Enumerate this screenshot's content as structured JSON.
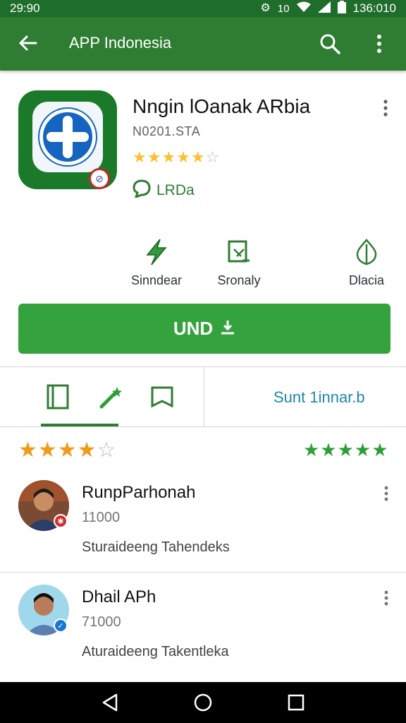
{
  "status_bar": {
    "time": "29:90",
    "clock_right": "136:010",
    "extra_text": "10"
  },
  "app_bar": {
    "title": "APP Indonesia"
  },
  "app": {
    "name": "Nngin lOanak ARbia",
    "developer": "N0201.STA",
    "rating_stars": 4.5,
    "tag": "LRDa"
  },
  "features": [
    {
      "label": "Sinndear",
      "icon": "bolt-icon"
    },
    {
      "label": "Sronaly",
      "icon": "edit-note-icon"
    },
    {
      "label": "Dlacia",
      "icon": "leaf-icon"
    }
  ],
  "install": {
    "label": "UND"
  },
  "tabs": {
    "text": "Sunt 1innar.b"
  },
  "ratings": {
    "left_stars": 4,
    "right_stars": 5
  },
  "reviews": [
    {
      "name": "RunpParhonah",
      "count": "11000",
      "text": "Sturaideeng Tahendeks"
    },
    {
      "name": "Dhail APh",
      "count": "71000",
      "text": "Aturaideeng Takentleka"
    }
  ],
  "colors": {
    "primary": "#2e7d32",
    "install": "#34a33d",
    "accent_text": "#1e88a8",
    "star_gold": "#f09a1a"
  }
}
